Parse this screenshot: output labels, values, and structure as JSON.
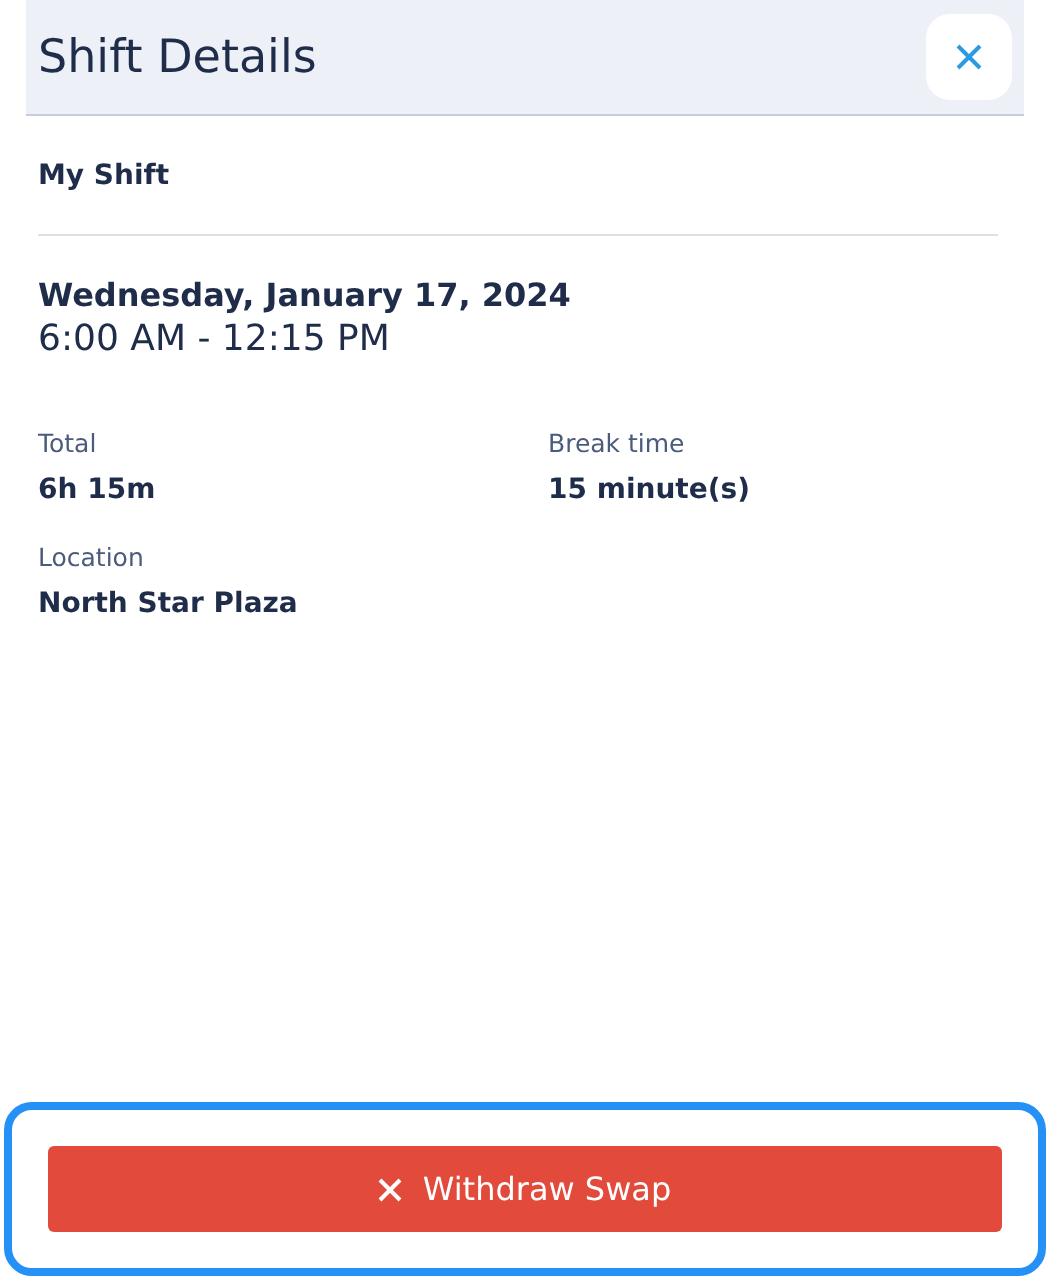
{
  "header": {
    "title": "Shift Details"
  },
  "section_title": "My Shift",
  "date": "Wednesday, January 17, 2024",
  "time": "6:00 AM - 12:15 PM",
  "details": [
    {
      "label": "Total",
      "value": "6h 15m"
    },
    {
      "label": "Break time",
      "value": "15 minute(s)"
    },
    {
      "label": "Location",
      "value": "North Star Plaza"
    }
  ],
  "action": {
    "label": "Withdraw Swap",
    "focused": true
  }
}
